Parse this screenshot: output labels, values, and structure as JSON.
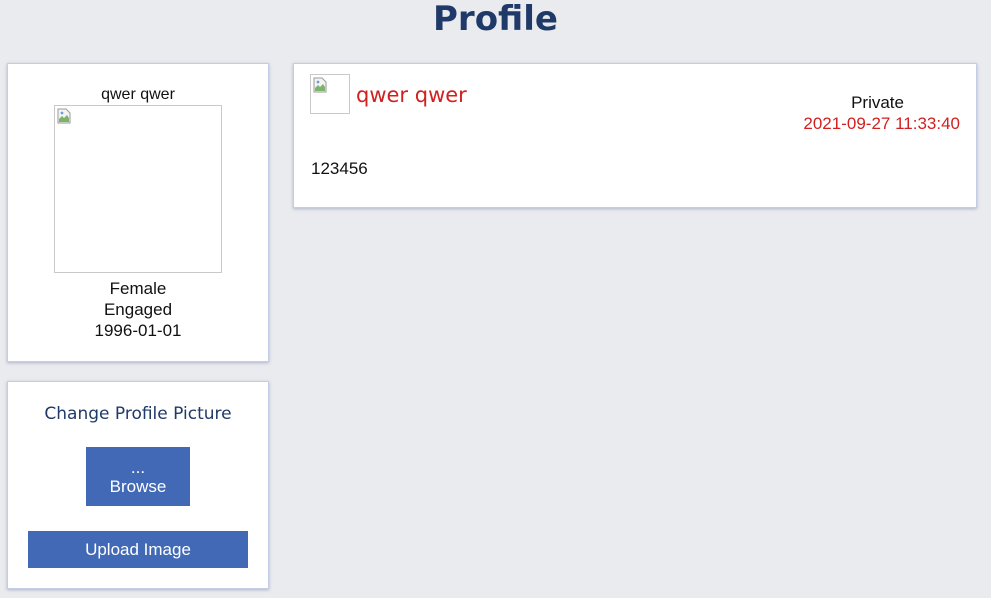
{
  "page": {
    "title": "Profile"
  },
  "profile": {
    "name": "qwer qwer",
    "gender": "Female",
    "relationship_status": "Engaged",
    "birthdate": "1996-01-01",
    "avatar_icon": "broken-image-icon"
  },
  "upload": {
    "title": "Change Profile Picture",
    "browse_ellipsis": "...",
    "browse_label": "Browse",
    "upload_label": "Upload Image"
  },
  "post": {
    "author": "qwer qwer",
    "privacy": "Private",
    "timestamp": "2021-09-27 11:33:40",
    "body": "123456",
    "avatar_icon": "broken-image-icon"
  },
  "colors": {
    "background": "#eaebee",
    "accent_blue": "#4169b5",
    "title_navy": "#1f3a68",
    "highlight_red": "#d21f1f"
  }
}
